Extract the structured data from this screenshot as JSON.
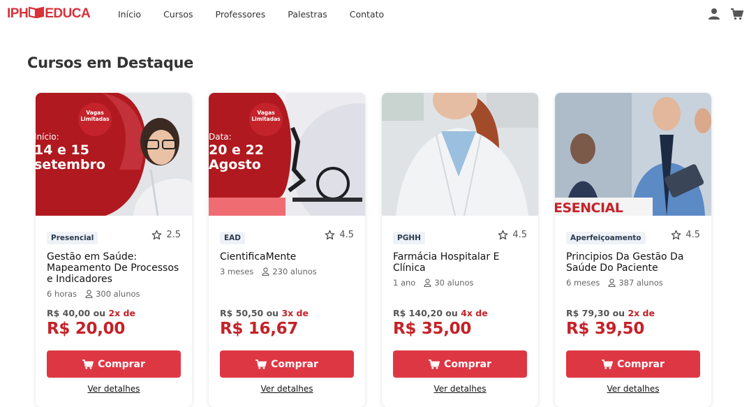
{
  "header": {
    "logo_left": "IPH",
    "logo_right": "EDUCA",
    "nav": [
      "Início",
      "Cursos",
      "Professores",
      "Palestras",
      "Contato"
    ],
    "icons": [
      "user-icon",
      "cart-icon"
    ]
  },
  "section_title": "Cursos em Destaque",
  "colors": {
    "brand": "#d8313a",
    "button": "#de3744",
    "price": "#c42228"
  },
  "cards": [
    {
      "image": {
        "banner_small": "Vagas Limitadas",
        "date_label": "Início:",
        "date_big1": "14 e 15",
        "date_big2": "setembro"
      },
      "badge": "Presencial",
      "rating": "2.5",
      "title": "Gestão em Saúde: Mapeamento De Processos e Indicadores",
      "duration": "6 horas",
      "students": "300 alunos",
      "price_old": "R$ 40,00",
      "or": "ou",
      "installments": "2x de",
      "price_new": "R$ 20,00",
      "buy": "Comprar",
      "details": "Ver detalhes"
    },
    {
      "image": {
        "banner_small": "Vagas Limitadas",
        "date_label": "Data:",
        "date_big1": "20 e 22",
        "date_big2": "Agosto"
      },
      "badge": "EAD",
      "rating": "4.5",
      "title": "CientificaMente",
      "duration": "3 meses",
      "students": "230 alunos",
      "price_old": "R$ 50,50",
      "or": "ou",
      "installments": "3x de",
      "price_new": "R$ 16,67",
      "buy": "Comprar",
      "details": "Ver detalhes"
    },
    {
      "image": {},
      "badge": "PGHH",
      "rating": "4.5",
      "title": "Farmácia Hospitalar E Clínica",
      "duration": "1 ano",
      "students": "30 alunos",
      "price_old": "R$ 140,20",
      "or": "ou",
      "installments": "4x de",
      "price_new": "R$ 35,00",
      "buy": "Comprar",
      "details": "Ver detalhes"
    },
    {
      "image": {
        "banner_text": "ESENCIAL"
      },
      "badge": "Aperfeiçoamento",
      "rating": "4.5",
      "title": "Principios Da Gestão Da Saúde Do Paciente",
      "duration": "6 meses",
      "students": "387 alunos",
      "price_old": "R$ 79,30",
      "or": "ou",
      "installments": "2x de",
      "price_new": "R$ 39,50",
      "buy": "Comprar",
      "details": "Ver detalhes"
    }
  ]
}
